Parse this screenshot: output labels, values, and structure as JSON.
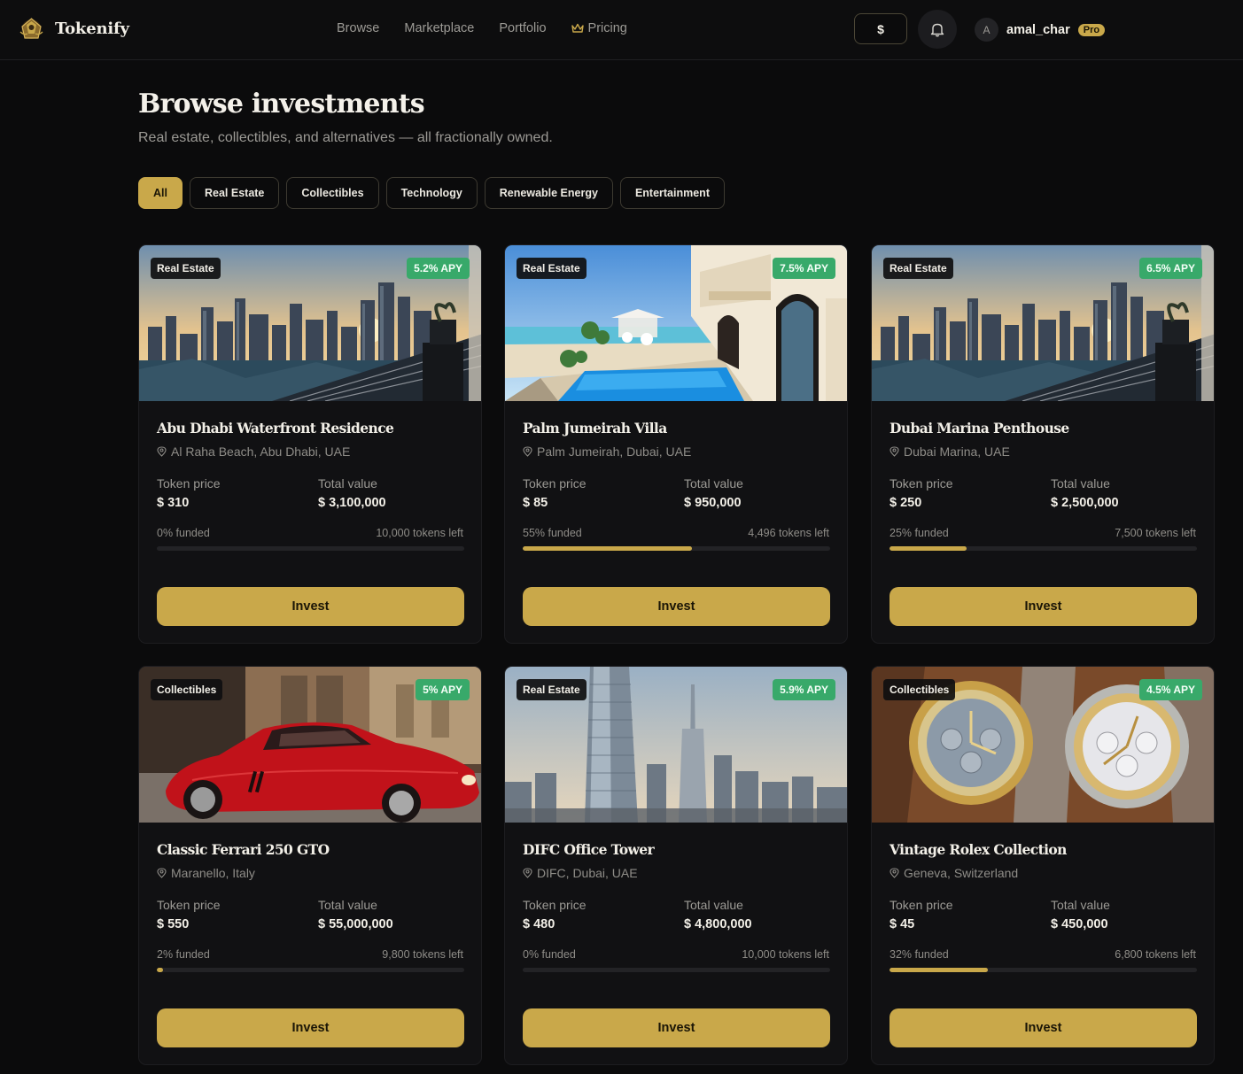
{
  "app": {
    "brand": "Tokenify"
  },
  "nav": {
    "items": [
      "Browse",
      "Marketplace",
      "Portfolio",
      "Pricing"
    ]
  },
  "header": {
    "currency": "$",
    "avatar_initial": "A",
    "username": "amal_char",
    "plan_badge": "Pro"
  },
  "page": {
    "title": "Browse investments",
    "subtitle": "Real estate, collectibles, and alternatives — all fractionally owned."
  },
  "filters": [
    {
      "label": "All",
      "active": true
    },
    {
      "label": "Real Estate",
      "active": false
    },
    {
      "label": "Collectibles",
      "active": false
    },
    {
      "label": "Technology",
      "active": false
    },
    {
      "label": "Renewable Energy",
      "active": false
    },
    {
      "label": "Entertainment",
      "active": false
    }
  ],
  "labels": {
    "token_price": "Token price",
    "total_value": "Total value",
    "invest": "Invest"
  },
  "cards": [
    {
      "category": "Real Estate",
      "apy": "5.2% APY",
      "title": "Abu Dhabi Waterfront Residence",
      "location": "Al Raha Beach, Abu Dhabi, UAE",
      "token_price": "$ 310",
      "total_value": "$ 3,100,000",
      "funded": "0% funded",
      "tokens_left": "10,000 tokens left",
      "funded_pct": 0,
      "image": "city-balcony"
    },
    {
      "category": "Real Estate",
      "apy": "7.5% APY",
      "title": "Palm Jumeirah Villa",
      "location": "Palm Jumeirah, Dubai, UAE",
      "token_price": "$ 85",
      "total_value": "$ 950,000",
      "funded": "55% funded",
      "tokens_left": "4,496 tokens left",
      "funded_pct": 55,
      "image": "villa-pool"
    },
    {
      "category": "Real Estate",
      "apy": "6.5% APY",
      "title": "Dubai Marina Penthouse",
      "location": "Dubai Marina, UAE",
      "token_price": "$ 250",
      "total_value": "$ 2,500,000",
      "funded": "25% funded",
      "tokens_left": "7,500 tokens left",
      "funded_pct": 25,
      "image": "city-balcony"
    },
    {
      "category": "Collectibles",
      "apy": "5% APY",
      "title": "Classic Ferrari 250 GTO",
      "location": "Maranello, Italy",
      "token_price": "$ 550",
      "total_value": "$ 55,000,000",
      "funded": "2% funded",
      "tokens_left": "9,800 tokens left",
      "funded_pct": 2,
      "image": "red-car"
    },
    {
      "category": "Real Estate",
      "apy": "5.9% APY",
      "title": "DIFC Office Tower",
      "location": "DIFC, Dubai, UAE",
      "token_price": "$ 480",
      "total_value": "$ 4,800,000",
      "funded": "0% funded",
      "tokens_left": "10,000 tokens left",
      "funded_pct": 0,
      "image": "skyscraper"
    },
    {
      "category": "Collectibles",
      "apy": "4.5% APY",
      "title": "Vintage Rolex Collection",
      "location": "Geneva, Switzerland",
      "token_price": "$ 45",
      "total_value": "$ 450,000",
      "funded": "32% funded",
      "tokens_left": "6,800 tokens left",
      "funded_pct": 32,
      "image": "watches"
    }
  ],
  "icons": {
    "logo": "crest-logo-icon",
    "pricing": "crown-icon",
    "notifications": "bell-icon",
    "location": "map-pin-icon"
  },
  "colors": {
    "accent": "#c9a84a",
    "apy": "#38a96a",
    "background": "#0b0b0c",
    "card": "#111113"
  }
}
